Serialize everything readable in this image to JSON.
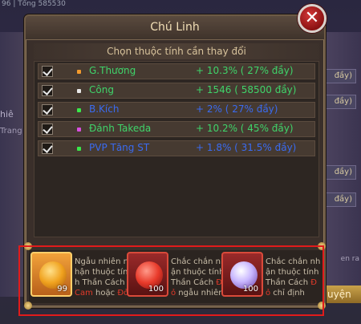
{
  "background": {
    "top_text": "96  | Tổng      585530",
    "left_labels": [
      "hiê",
      "Trang"
    ],
    "right_values": [
      "đầy)",
      "đầy)",
      "đầy)",
      "đầy)"
    ],
    "right_small": "en ra",
    "right_button": "uyện"
  },
  "dialog": {
    "title": "Chú Linh",
    "close_symbol": "✕",
    "subtitle": "Chọn thuộc tính cần thay đổi"
  },
  "attributes": [
    {
      "name": "G.Thương",
      "value": "+ 10.3%  ( 27%  đầy)",
      "name_color": "#3fd46a",
      "value_color": "#3fd46a",
      "bullet_color": "#f39a2c",
      "checked": true
    },
    {
      "name": "Công",
      "value": "+ 1546  ( 58500  đầy)",
      "name_color": "#3fd46a",
      "value_color": "#3fd46a",
      "bullet_color": "#e8e8e8",
      "checked": true
    },
    {
      "name": "B.Kích",
      "value": "+ 2%  ( 27%  đầy)",
      "name_color": "#3a6bf0",
      "value_color": "#3a6bf0",
      "bullet_color": "#39e84a",
      "checked": true
    },
    {
      "name": "Đánh Takeda",
      "value": "+ 10.2%  ( 45%  đầy)",
      "name_color": "#3fd46a",
      "value_color": "#3fd46a",
      "bullet_color": "#d84fe0",
      "checked": true
    },
    {
      "name": "PVP Tăng ST",
      "value": "+ 1.8%  ( 31.5%  đầy)",
      "name_color": "#3a6bf0",
      "value_color": "#3a6bf0",
      "bullet_color": "#39e84a",
      "checked": true
    }
  ],
  "items": [
    {
      "count": "99",
      "desc_a": "Ngẫu nhiên nhận thuộc tính Thần Cách ",
      "desc_red": "Cam",
      "desc_b": " hoặc ",
      "desc_red2": "Đỏ",
      "desc_c": "",
      "gem_color": "#f0a21e",
      "frame": "orange"
    },
    {
      "count": "100",
      "desc_a": "Chắc chắn nhận thuộc tính Thần Cách ",
      "desc_red": "Đỏ",
      "desc_b": " ngẫu nhiên",
      "desc_red2": "",
      "desc_c": "",
      "gem_color": "#e83a2a",
      "frame": "red"
    },
    {
      "count": "100",
      "desc_a": "Chắc chắn nhận thuộc tính Thần Cách ",
      "desc_red": "Đỏ",
      "desc_b": " chỉ định",
      "desc_red2": "",
      "desc_c": "",
      "gem_color": "#c8b6ff",
      "frame": "red"
    }
  ]
}
